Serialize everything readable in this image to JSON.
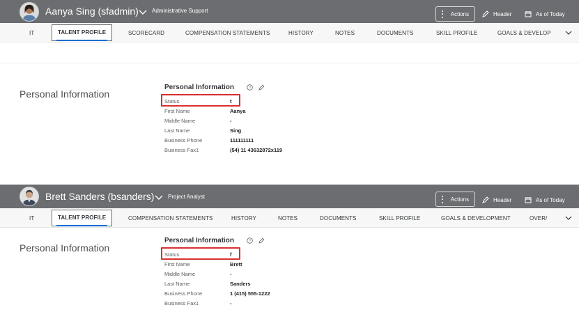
{
  "panels": [
    {
      "user": {
        "name": "Aanya Sing (sfadmin)",
        "role": "Administrative Support"
      },
      "actions": {
        "actions_label": "Actions",
        "header_label": "Header",
        "as_of_label": "As of Today"
      },
      "tabs": [
        "IT",
        "TALENT PROFILE",
        "SCORECARD",
        "COMPENSATION STATEMENTS",
        "HISTORY",
        "NOTES",
        "DOCUMENTS",
        "SKILL PROFILE",
        "GOALS & DEVELOP"
      ],
      "section_title": "Personal Information",
      "form_title": "Personal Information",
      "rows": [
        {
          "label": "Status",
          "value": "t"
        },
        {
          "label": "First Name",
          "value": "Aanya"
        },
        {
          "label": "Middle Name",
          "value": "-"
        },
        {
          "label": "Last Name",
          "value": "Sing"
        },
        {
          "label": "Business Phone",
          "value": "111111111"
        },
        {
          "label": "Business Fax1",
          "value": "(54) 11 43632872x119"
        }
      ]
    },
    {
      "user": {
        "name": "Brett Sanders (bsanders)",
        "role": "Project Analyst"
      },
      "actions": {
        "actions_label": "Actions",
        "header_label": "Header",
        "as_of_label": "As of Today"
      },
      "tabs": [
        "IT",
        "TALENT PROFILE",
        "COMPENSATION STATEMENTS",
        "HISTORY",
        "NOTES",
        "DOCUMENTS",
        "SKILL PROFILE",
        "GOALS & DEVELOPMENT",
        "OVER/"
      ],
      "section_title": "Personal Information",
      "form_title": "Personal Information",
      "rows": [
        {
          "label": "Status",
          "value": "f"
        },
        {
          "label": "First Name",
          "value": "Brett"
        },
        {
          "label": "Middle Name",
          "value": "-"
        },
        {
          "label": "Last Name",
          "value": "Sanders"
        },
        {
          "label": "Business Phone",
          "value": "1 (415) 555-1222"
        },
        {
          "label": "Business Fax1",
          "value": "-"
        }
      ]
    }
  ],
  "colors": {
    "header_bg": "#6b6d70",
    "highlight": "#d8302f",
    "active_tab_underline": "#0a6ed1"
  },
  "icons": {
    "avatar": "avatar-photo",
    "chevron": "chevron-down-icon",
    "actions": "more-vertical-icon",
    "header": "pencil-icon",
    "calendar": "calendar-icon",
    "help": "help-circle-icon",
    "edit": "pencil-icon",
    "more": "chevron-down-icon"
  }
}
